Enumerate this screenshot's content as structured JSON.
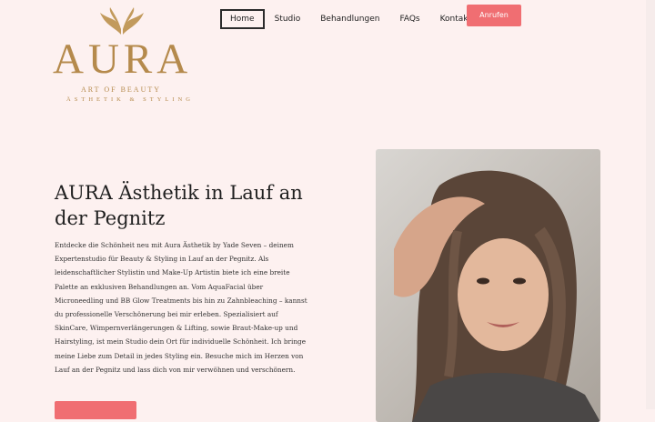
{
  "brand": {
    "name": "AURA",
    "tagline_1": "ART OF BEAUTY",
    "tagline_2": "ÄSTHETIK & STYLING",
    "color": "#b58a4c"
  },
  "nav": {
    "items": [
      {
        "label": "Home",
        "active": true
      },
      {
        "label": "Studio"
      },
      {
        "label": "Behandlungen"
      },
      {
        "label": "FAQs"
      },
      {
        "label": "Kontakt"
      }
    ],
    "call_button": "Anrufen"
  },
  "hero": {
    "title": "AURA Ästhetik in Lauf an der Pegnitz",
    "text": "Entdecke die Schönheit neu mit Aura Ästhetik by Yade Seven – deinem Expertenstudio für Beauty & Styling in Lauf an der Pegnitz. Als leidenschaftlicher Stylistin und Make-Up Artistin biete ich eine breite Palette an exklusiven Behandlungen an. Vom AquaFacial über Microneedling und BB Glow Treatments bis hin zu Zahnbleaching – kannst du professionelle Verschönerung bei mir erleben. Spezialisiert auf SkinCare, Wimpernverlängerungen & Lifting, sowie Braut-Make-up und Hairstyling, ist mein Studio dein Ort für individuelle Schönheit. Ich bringe meine Liebe zum Detail in jedes Styling ein. Besuche mich im Herzen von Lauf an der Pegnitz und lass dich von mir verwöhnen und verschönern."
  },
  "colors": {
    "accent": "#f06e72",
    "background": "#fdf1f0"
  }
}
